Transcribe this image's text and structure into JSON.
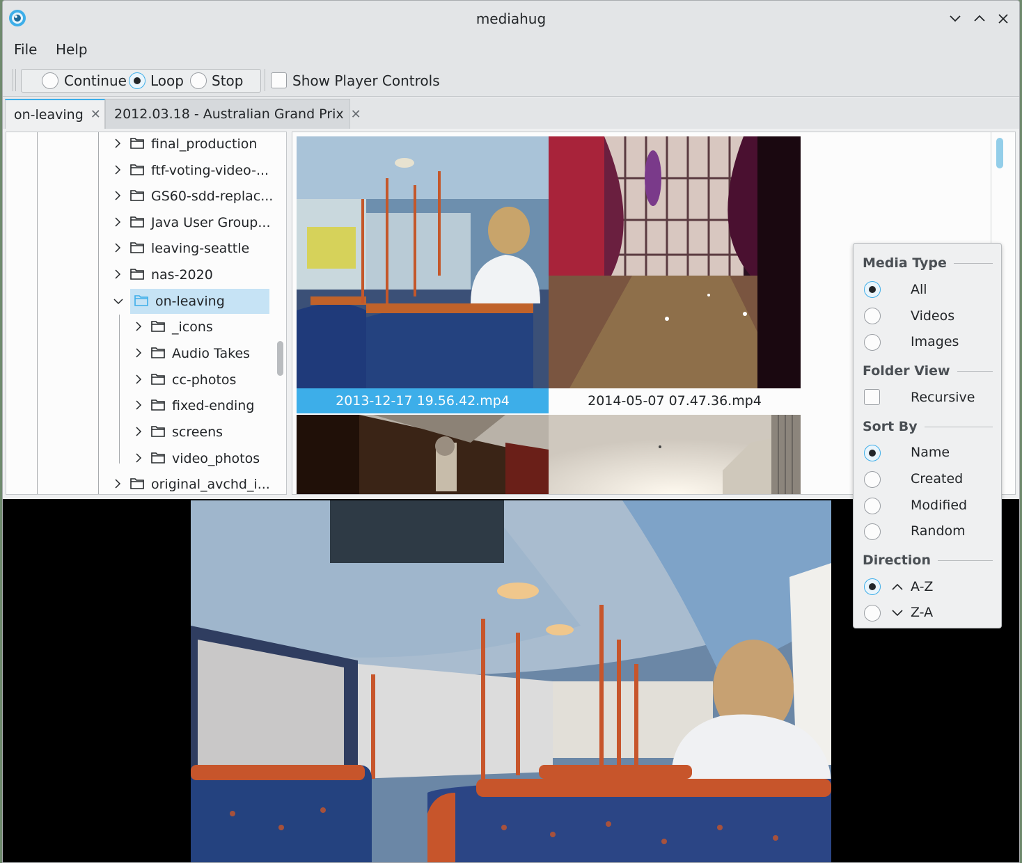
{
  "window": {
    "title": "mediahug"
  },
  "menu": {
    "file": "File",
    "help": "Help"
  },
  "toolbar": {
    "continue_label": "Continue",
    "loop_label": "Loop",
    "stop_label": "Stop",
    "selected_mode": "Loop",
    "show_controls_label": "Show Player Controls",
    "show_controls_checked": false
  },
  "tabs": [
    {
      "label": "on-leaving",
      "active": true
    },
    {
      "label": "2012.03.18 - Australian Grand Prix",
      "active": false
    }
  ],
  "tree": {
    "items": [
      {
        "label": "final_production"
      },
      {
        "label": "ftf-voting-video-..."
      },
      {
        "label": "GS60-sdd-replac..."
      },
      {
        "label": "Java User Group..."
      },
      {
        "label": "leaving-seattle"
      },
      {
        "label": "nas-2020"
      },
      {
        "label": "on-leaving",
        "selected": true,
        "expanded": true
      },
      {
        "label": "_icons"
      },
      {
        "label": "Audio Takes"
      },
      {
        "label": "cc-photos"
      },
      {
        "label": "fixed-ending"
      },
      {
        "label": "screens"
      },
      {
        "label": "video_photos"
      },
      {
        "label": "original_avchd_i..."
      }
    ]
  },
  "thumbnails": [
    {
      "label": "2013-12-17 19.56.42.mp4",
      "selected": true
    },
    {
      "label": "2014-05-07 07.47.36.mp4",
      "selected": false
    }
  ],
  "options": {
    "media_type_title": "Media Type",
    "media_type": [
      "All",
      "Videos",
      "Images"
    ],
    "media_type_selected": "All",
    "folder_view_title": "Folder View",
    "recursive_label": "Recursive",
    "recursive_checked": false,
    "sort_by_title": "Sort By",
    "sort_by": [
      "Name",
      "Created",
      "Modified",
      "Random"
    ],
    "sort_by_selected": "Name",
    "direction_title": "Direction",
    "direction_az": "A-Z",
    "direction_za": "Z-A",
    "direction_selected": "A-Z"
  },
  "colors": {
    "accent": "#3daee9",
    "selection": "#c6e3f5"
  }
}
